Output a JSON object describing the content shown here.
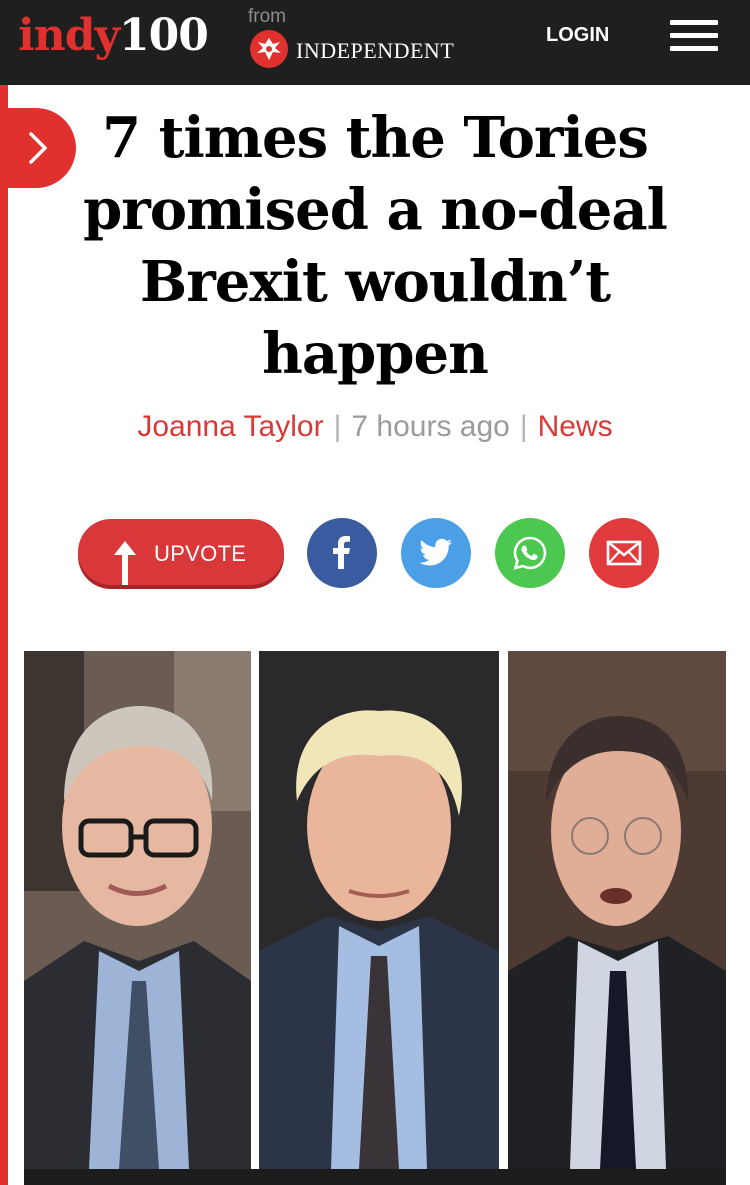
{
  "header": {
    "logo_part1": "indy",
    "logo_part2": "100",
    "from_label": "from",
    "publisher": "INDEPENDENT",
    "login_label": "LOGIN"
  },
  "article": {
    "headline": "7 times the Tories promised a no-deal Brexit wouldn’t happen",
    "author": "Joanna Taylor",
    "separator": "|",
    "time_ago": "7 hours ago",
    "section": "News"
  },
  "actions": {
    "upvote_label": "UPVOTE",
    "share_icons": [
      "facebook-icon",
      "twitter-icon",
      "whatsapp-icon",
      "email-icon"
    ]
  },
  "colors": {
    "brand_red": "#e0312f",
    "header_bg": "#1f1f1f",
    "facebook": "#3a5ba0",
    "twitter": "#4a9fe6",
    "whatsapp": "#4cc74f",
    "email": "#e03a3c"
  }
}
